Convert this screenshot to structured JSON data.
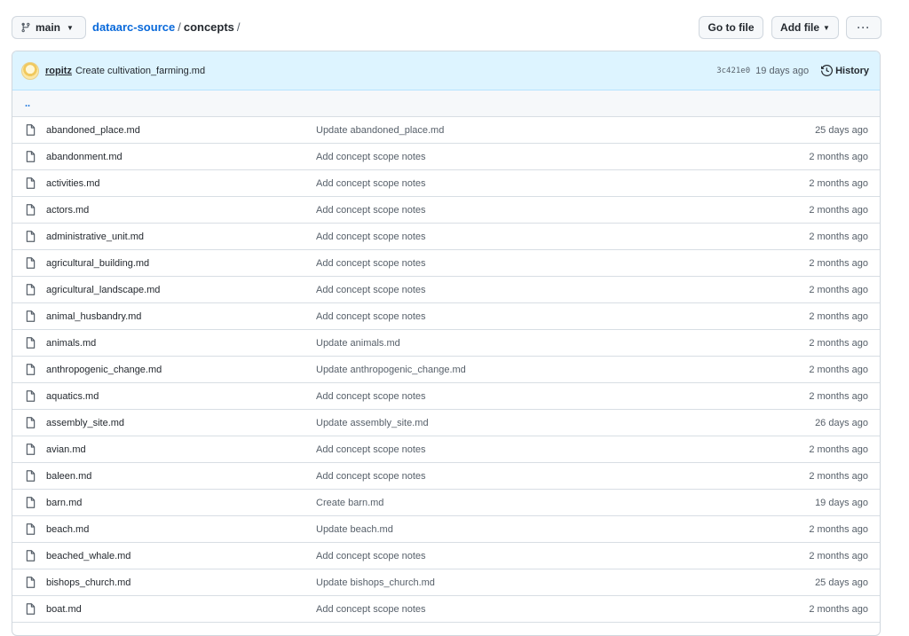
{
  "toolbar": {
    "branch": "main",
    "repo": "dataarc-source",
    "folder": "concepts",
    "separator": "/",
    "goto_file": "Go to file",
    "add_file": "Add file",
    "more": "···"
  },
  "commit": {
    "author": "ropitz",
    "message": "Create cultivation_farming.md",
    "sha": "3c421e0",
    "age": "19 days ago",
    "history": "History"
  },
  "parent_link": "..",
  "files": [
    {
      "name": "abandoned_place.md",
      "message": "Update abandoned_place.md",
      "age": "25 days ago"
    },
    {
      "name": "abandonment.md",
      "message": "Add concept scope notes",
      "age": "2 months ago"
    },
    {
      "name": "activities.md",
      "message": "Add concept scope notes",
      "age": "2 months ago"
    },
    {
      "name": "actors.md",
      "message": "Add concept scope notes",
      "age": "2 months ago"
    },
    {
      "name": "administrative_unit.md",
      "message": "Add concept scope notes",
      "age": "2 months ago"
    },
    {
      "name": "agricultural_building.md",
      "message": "Add concept scope notes",
      "age": "2 months ago"
    },
    {
      "name": "agricultural_landscape.md",
      "message": "Add concept scope notes",
      "age": "2 months ago"
    },
    {
      "name": "animal_husbandry.md",
      "message": "Add concept scope notes",
      "age": "2 months ago"
    },
    {
      "name": "animals.md",
      "message": "Update animals.md",
      "age": "2 months ago"
    },
    {
      "name": "anthropogenic_change.md",
      "message": "Update anthropogenic_change.md",
      "age": "2 months ago"
    },
    {
      "name": "aquatics.md",
      "message": "Add concept scope notes",
      "age": "2 months ago"
    },
    {
      "name": "assembly_site.md",
      "message": "Update assembly_site.md",
      "age": "26 days ago"
    },
    {
      "name": "avian.md",
      "message": "Add concept scope notes",
      "age": "2 months ago"
    },
    {
      "name": "baleen.md",
      "message": "Add concept scope notes",
      "age": "2 months ago"
    },
    {
      "name": "barn.md",
      "message": "Create barn.md",
      "age": "19 days ago"
    },
    {
      "name": "beach.md",
      "message": "Update beach.md",
      "age": "2 months ago"
    },
    {
      "name": "beached_whale.md",
      "message": "Add concept scope notes",
      "age": "2 months ago"
    },
    {
      "name": "bishops_church.md",
      "message": "Update bishops_church.md",
      "age": "25 days ago"
    },
    {
      "name": "boat.md",
      "message": "Add concept scope notes",
      "age": "2 months ago"
    }
  ]
}
